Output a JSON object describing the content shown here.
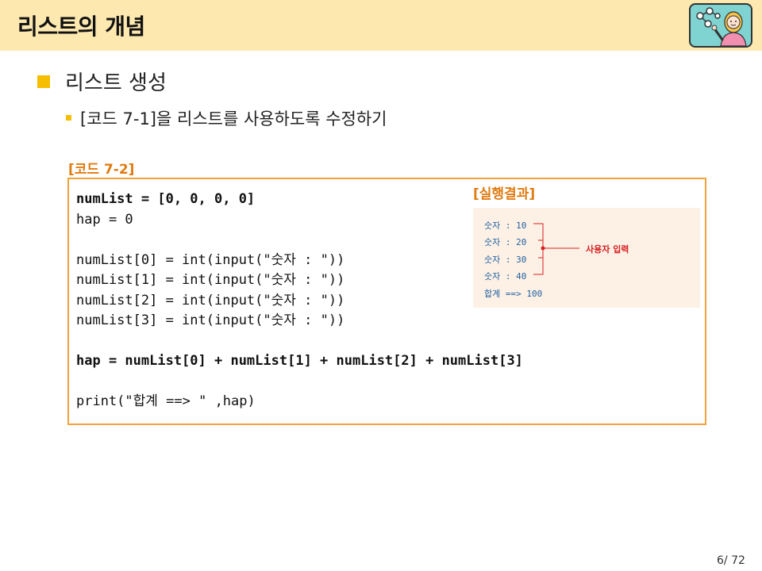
{
  "header": {
    "title": "리스트의 개념"
  },
  "section": {
    "heading": "리스트 생성",
    "subheading": "[코드 7-1]을 리스트를 사용하도록 수정하기"
  },
  "code_block": {
    "label": "[코드 7-2]",
    "lines": [
      "numList = [0, 0, 0, 0]",
      "hap = 0",
      "",
      "numList[0] = int(input(\"숫자 : \"))",
      "numList[1] = int(input(\"숫자 : \"))",
      "numList[2] = int(input(\"숫자 : \"))",
      "numList[3] = int(input(\"숫자 : \"))",
      "",
      "hap = numList[0] + numList[1] + numList[2] + numList[3]",
      "",
      "print(\"합계 ==> \" ,hap)"
    ]
  },
  "result": {
    "label": "[실행결과]",
    "lines": [
      "숫자 : 10",
      "숫자 : 20",
      "숫자 : 30",
      "숫자 : 40",
      "합계 ==> 100"
    ],
    "annotation": "사용자 입력"
  },
  "page": {
    "current_label": "6/ 72"
  },
  "colors": {
    "header_bg": "#fde9b0",
    "bullet": "#f6be00",
    "accent_orange": "#e07b10",
    "code_border": "#f2a13a",
    "result_bg": "#fdf1e6",
    "output_text": "#1f5f9f",
    "annotation": "#d62020"
  },
  "icons": {
    "header_illustration": "teacher-avatar-icon"
  }
}
